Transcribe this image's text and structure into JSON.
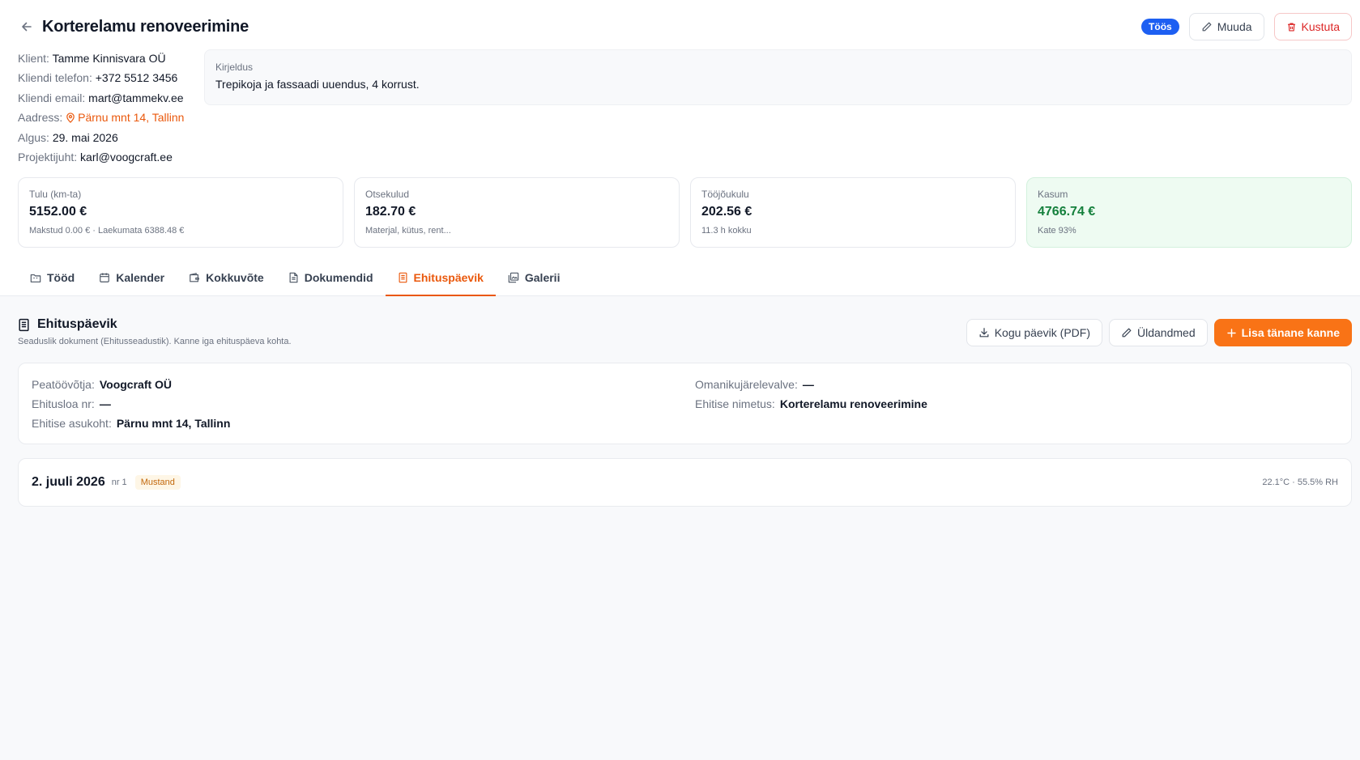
{
  "header": {
    "title": "Korterelamu renoveerimine",
    "status": "Töös",
    "edit_label": "Muuda",
    "delete_label": "Kustuta"
  },
  "client_info": [
    {
      "label": "Klient:",
      "value": "Tamme Kinnisvara OÜ"
    },
    {
      "label": "Kliendi telefon:",
      "value": "+372 5512 3456"
    },
    {
      "label": "Kliendi email:",
      "value": "mart@tammekv.ee"
    },
    {
      "label": "Aadress:",
      "value": "Pärnu mnt 14, Tallinn"
    },
    {
      "label": "Algus:",
      "value": "29. mai 2026"
    },
    {
      "label": "Projektijuht:",
      "value": "karl@voogcraft.ee"
    }
  ],
  "description": {
    "label": "Kirjeldus",
    "text": "Trepikoja ja fassaadi uuendus, 4 korrust."
  },
  "stats": [
    {
      "label": "Tulu (km-ta)",
      "value": "5152.00 €",
      "sub": "Makstud 0.00 € · Laekumata 6388.48 €"
    },
    {
      "label": "Otsekulud",
      "value": "182.70 €",
      "sub": "Materjal, kütus, rent..."
    },
    {
      "label": "Tööjõukulu",
      "value": "202.56 €",
      "sub": "11.3 h kokku"
    },
    {
      "label": "Kasum",
      "value": "4766.74 €",
      "sub": "Kate 93%"
    }
  ],
  "tabs": [
    {
      "label": "Tööd",
      "icon": "folder-icon"
    },
    {
      "label": "Kalender",
      "icon": "calendar-icon"
    },
    {
      "label": "Kokkuvõte",
      "icon": "wallet-icon"
    },
    {
      "label": "Dokumendid",
      "icon": "document-icon"
    },
    {
      "label": "Ehituspäevik",
      "icon": "notebook-icon",
      "active": true
    },
    {
      "label": "Galerii",
      "icon": "gallery-icon"
    }
  ],
  "section": {
    "title": "Ehituspäevik",
    "subtitle": "Seaduslik dokument (Ehitusseadustik). Kanne iga ehituspäeva kohta.",
    "pdf_label": "Kogu päevik (PDF)",
    "general_label": "Üldandmed",
    "add_label": "Lisa tänane kanne"
  },
  "details": {
    "left": [
      {
        "label": "Peatöövõtja:",
        "value": "Voogcraft OÜ"
      },
      {
        "label": "Ehitusloa nr:",
        "value": "—"
      },
      {
        "label": "Ehitise asukoht:",
        "value": "Pärnu mnt 14, Tallinn"
      }
    ],
    "right": [
      {
        "label": "Omanikujärelevalve:",
        "value": "—"
      },
      {
        "label": "Ehitise nimetus:",
        "value": "Korterelamu renoveerimine"
      }
    ]
  },
  "entries": [
    {
      "date": "2. juuli 2026",
      "nr": "nr 1",
      "status": "Mustand",
      "weather": "22.1°C · 55.5% RH"
    }
  ],
  "colors": {
    "accent": "#f97316",
    "status_blue": "#1d5ff2",
    "danger": "#dc2626",
    "profit": "#15803d"
  }
}
